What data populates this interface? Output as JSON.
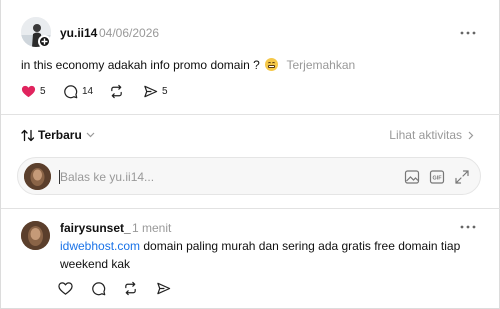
{
  "post": {
    "username": "yu.ii14",
    "date": "04/06/2026",
    "text": "in this economy adakah info promo domain ?",
    "translate_label": "Terjemahkan",
    "likes": "5",
    "comments": "14",
    "shares": "5"
  },
  "sort": {
    "label": "Terbaru",
    "activity_label": "Lihat aktivitas"
  },
  "reply": {
    "placeholder": "Balas ke yu.ii14..."
  },
  "comment": {
    "username": "fairysunset_",
    "time": "1 menit",
    "link_text": "idwebhost.com",
    "text": " domain paling murah dan sering ada gratis free domain tiap weekend kak"
  },
  "colors": {
    "like": "#e0245e",
    "link": "#1a73e8",
    "muted": "#999999"
  },
  "icons": [
    "heart-icon",
    "comment-icon",
    "repost-icon",
    "share-icon",
    "more-icon",
    "sort-icon",
    "chevron-down-icon",
    "chevron-right-icon",
    "image-icon",
    "gif-icon",
    "expand-icon"
  ]
}
